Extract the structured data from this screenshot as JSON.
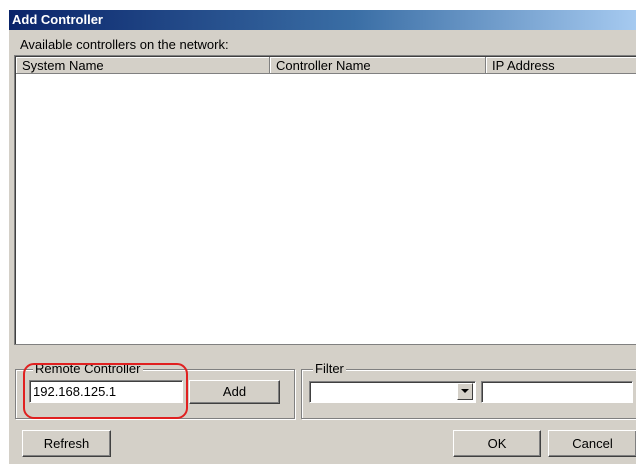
{
  "window": {
    "title": "Add Controller"
  },
  "list": {
    "label": "Available controllers on the network:",
    "columns": [
      "System Name",
      "Controller Name",
      "IP Address"
    ],
    "rows": []
  },
  "remote_controller": {
    "group_label": "Remote Controller",
    "ip_value": "192.168.125.1",
    "add_label": "Add"
  },
  "filter": {
    "group_label": "Filter",
    "selected": "",
    "text": ""
  },
  "buttons": {
    "refresh": "Refresh",
    "ok": "OK",
    "cancel": "Cancel"
  },
  "colors": {
    "highlight": "#e02020",
    "title_bar": "#0a246a"
  }
}
